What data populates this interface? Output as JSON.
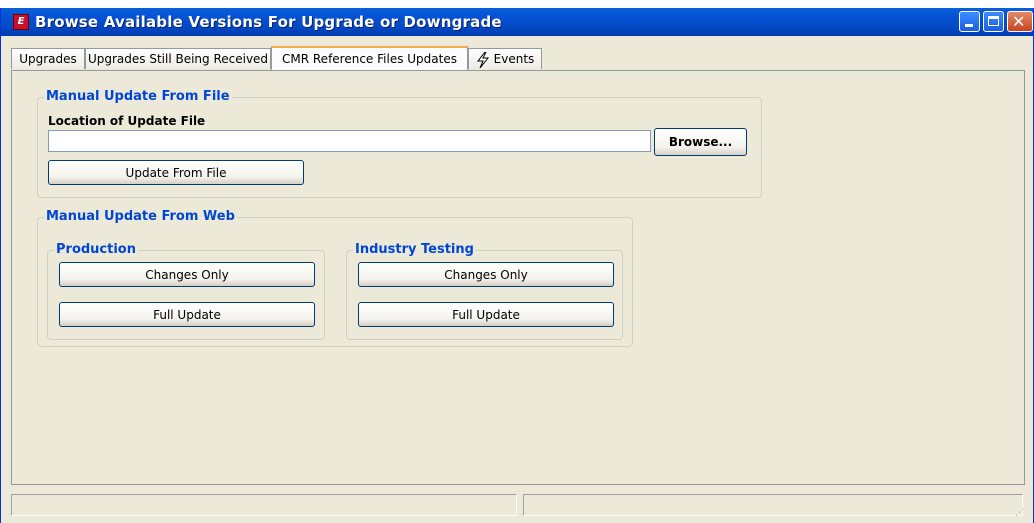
{
  "window": {
    "title": "Browse Available Versions For Upgrade or Downgrade",
    "app_icon_letter": "E",
    "close_glyph": "✕"
  },
  "tabs": [
    {
      "label": "Upgrades",
      "active": false
    },
    {
      "label": "Upgrades Still Being Received",
      "active": false
    },
    {
      "label": "CMR Reference Files Updates",
      "active": true
    },
    {
      "label": "Events",
      "active": false,
      "icon": "lightning-bolt-icon"
    }
  ],
  "file_update": {
    "legend": "Manual Update From File",
    "location_label": "Location of Update File",
    "location_value": "",
    "browse_label": "Browse...",
    "update_button_label": "Update From File"
  },
  "web_update": {
    "legend": "Manual Update From Web",
    "production": {
      "legend": "Production",
      "changes_label": "Changes Only",
      "full_label": "Full Update"
    },
    "industry": {
      "legend": "Industry Testing",
      "changes_label": "Changes Only",
      "full_label": "Full Update"
    }
  },
  "status": {
    "pane1": "",
    "pane2": ""
  },
  "colors": {
    "titlebar": "#0453d5",
    "group_legend": "#0046d5",
    "active_tab_accent": "#f5a94a",
    "window_bg": "#ece9d8"
  }
}
